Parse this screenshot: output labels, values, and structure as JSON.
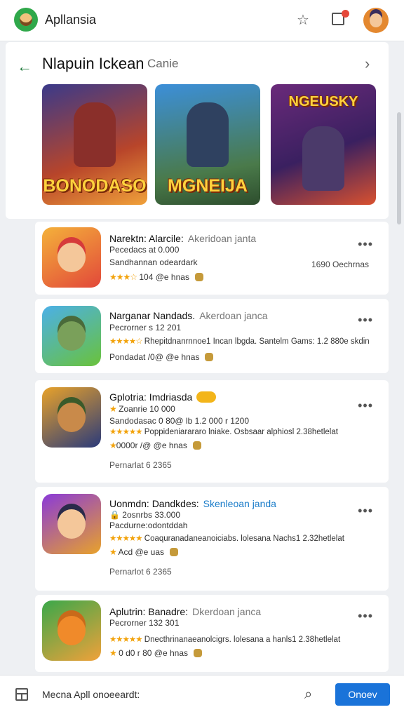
{
  "app": {
    "title": "Apllansia"
  },
  "section": {
    "title": "Nlapuin Ickean",
    "subtitle": "Canie"
  },
  "featured": [
    {
      "label": "BONODASO"
    },
    {
      "label": "MGNEIJA"
    },
    {
      "label": "NGEUSKY"
    }
  ],
  "apps": [
    {
      "name": "Narektn: Alarcile:",
      "tag": "Akeridoan janta",
      "line1": "Pecedacs at 0.000",
      "line2": "Sandhannan odeardark",
      "line3": "104 @e hnas",
      "right": "1690 Oechrnas"
    },
    {
      "name": "Narganar Nandads.",
      "tag": "Akerdoan janca",
      "line1": "Pecrorner s 12 201",
      "line2": "Rhepitdnanrnnoe1 Incan lbgda. Santelm Gams: 1.2 880e skdin",
      "line3": "Pondadat /0@ @e hnas"
    },
    {
      "name": "Gplotria: Imdriasda",
      "line1": "Zoanrie 10 000",
      "line2": "Sandodasac 0 80@ lb 1.2 000 r 1200",
      "line3": "Poppideniarararo lniake. Osbsaar alphiosl 2.38hetlelat",
      "line4": "0000r /@ @e hnas",
      "line5": "Pernarlat   6 2365"
    },
    {
      "name": "Uonmdn: Dandkdes:",
      "tag": "Skenleoan janda",
      "line1": "2osnrbs 33.000",
      "line2": "Pacdurne:odontddah",
      "line3": "Coaquranadaneanoiciabs. lolesana Nachs1 2.32hetlelat",
      "line4": "Acd @e uas",
      "line5": "Pernarlot   6 2365"
    },
    {
      "name": "Aplutrin: Banadre:",
      "tag": "Dkerdoan janca",
      "line1": "Pecrorner 132 301",
      "line2": "Dnecthrinanaeanolcigrs. lolesana a hanls1 2.38hetlelat",
      "line3": "0 d0 r 80 @e hnas"
    }
  ],
  "bottom": {
    "text": "Mecna Apll onoeeardt:",
    "button": "Onoev"
  },
  "icons": [
    "star-bookmark-icon",
    "inbox-icon",
    "back-arrow-icon",
    "chevron-right-icon",
    "more-icon",
    "grid-icon",
    "search-icon",
    "shopping-bag-icon"
  ],
  "colors": {
    "accent": "#1a73d9",
    "brand_green": "#2fa84a",
    "star": "#f2a20a"
  }
}
